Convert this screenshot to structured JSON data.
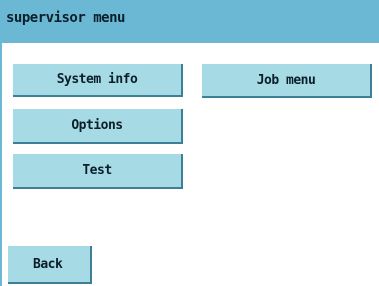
{
  "header": {
    "title": "supervisor menu"
  },
  "buttons": {
    "system_info": "System info",
    "options": "Options",
    "test": "Test",
    "job_menu": "Job menu",
    "back": "Back"
  },
  "colors": {
    "title_bar": "#6bb8d4",
    "button_fill": "#a6dae5",
    "button_shadow": "#3e7f98"
  }
}
